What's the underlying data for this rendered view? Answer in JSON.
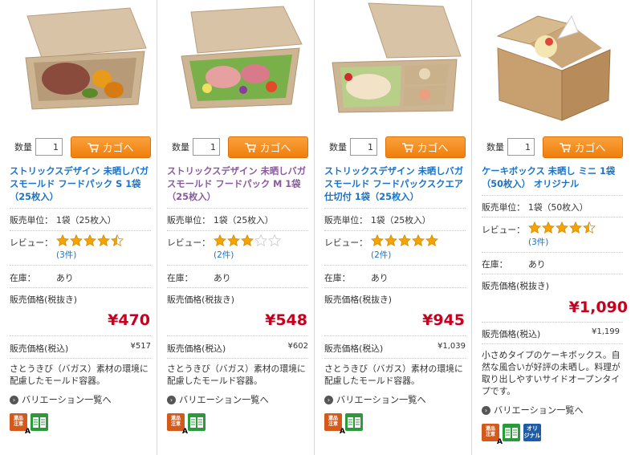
{
  "products": [
    {
      "qty_label": "数量",
      "qty_value": "1",
      "cart_label": "カゴへ",
      "title": "ストリックスデザイン 未晒しバガスモールド フードパック S 1袋（25枚入）",
      "unit_key": "販売単位：",
      "unit_val": "1袋（25枚入）",
      "review_key": "レビュー：",
      "rating": 4.5,
      "review_count": "(3件)",
      "stock_key": "在庫：",
      "stock_val": "あり",
      "price_ex_label": "販売価格(税抜き)",
      "price_ex": "¥470",
      "price_in_label": "販売価格(税込)",
      "price_in": "¥517",
      "desc": "さとうきび（バガス）素材の環境に配慮したモールド容器。",
      "variation": "バリエーション一覧へ",
      "icons": [
        "warning-icon",
        "book-icon"
      ]
    },
    {
      "qty_label": "数量",
      "qty_value": "1",
      "cart_label": "カゴへ",
      "title": "ストリックスデザイン 未晒しバガスモールド フードパック M 1袋（25枚入）",
      "unit_key": "販売単位：",
      "unit_val": "1袋（25枚入）",
      "review_key": "レビュー：",
      "rating": 3,
      "review_count": "(2件)",
      "stock_key": "在庫：",
      "stock_val": "あり",
      "price_ex_label": "販売価格(税抜き)",
      "price_ex": "¥548",
      "price_in_label": "販売価格(税込)",
      "price_in": "¥602",
      "desc": "さとうきび（バガス）素材の環境に配慮したモールド容器。",
      "variation": "バリエーション一覧へ",
      "icons": [
        "warning-icon",
        "book-icon"
      ]
    },
    {
      "qty_label": "数量",
      "qty_value": "1",
      "cart_label": "カゴへ",
      "title": "ストリックスデザイン 未晒しバガスモールド フードパックスクエア 仕切付 1袋（25枚入）",
      "unit_key": "販売単位：",
      "unit_val": "1袋（25枚入）",
      "review_key": "レビュー：",
      "rating": 5,
      "review_count": "(2件)",
      "stock_key": "在庫：",
      "stock_val": "あり",
      "price_ex_label": "販売価格(税抜き)",
      "price_ex": "¥945",
      "price_in_label": "販売価格(税込)",
      "price_in": "¥1,039",
      "desc": "さとうきび（バガス）素材の環境に配慮したモールド容器。",
      "variation": "バリエーション一覧へ",
      "icons": [
        "warning-icon",
        "book-icon"
      ]
    },
    {
      "qty_label": "数量",
      "qty_value": "1",
      "cart_label": "カゴへ",
      "title": "ケーキボックス 未晒し ミニ 1袋（50枚入） オリジナル",
      "unit_key": "販売単位：",
      "unit_val": "1袋（50枚入）",
      "review_key": "レビュー：",
      "rating": 4.5,
      "review_count": "(3件)",
      "stock_key": "在庫：",
      "stock_val": "あり",
      "price_ex_label": "販売価格(税抜き)",
      "price_ex": "¥1,090",
      "price_in_label": "販売価格(税込)",
      "price_in": "¥1,199",
      "desc": "小さめタイプのケーキボックス。自然な風合いが好評の未晒し。料理が取り出しやすいサイドオープンタイプです。",
      "variation": "バリエーション一覧へ",
      "icons": [
        "warning-icon",
        "book-icon",
        "original-icon"
      ]
    }
  ],
  "badges": {
    "warning_text_1": "還品",
    "warning_text_2": "注意",
    "warning_letter": "A",
    "original_text_1": "オリ",
    "original_text_2": "ジナル"
  },
  "colors": {
    "title_link": "#1a73c8",
    "title_visited": "#8a5aa0",
    "price": "#c8001e",
    "cart_button": "#f08c1e",
    "star": "#f5a300"
  }
}
